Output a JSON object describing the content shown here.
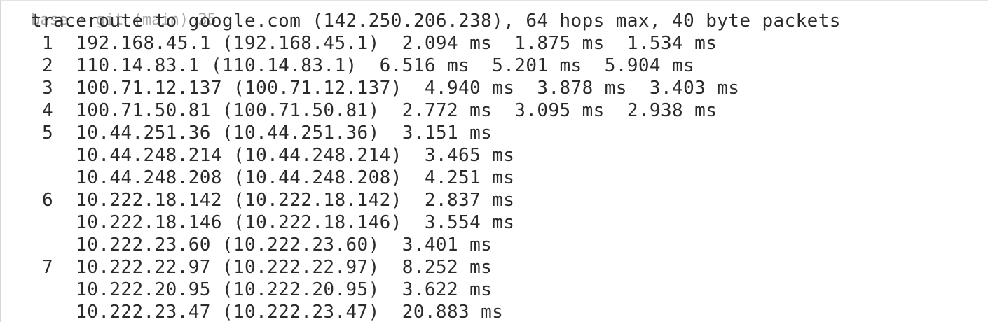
{
  "terminal": {
    "ghost_prompt": "base · git (main) 35",
    "header": "traceroute to google.com (142.250.206.238), 64 hops max, 40 byte packets",
    "lines": [
      " 1  192.168.45.1 (192.168.45.1)  2.094 ms  1.875 ms  1.534 ms",
      " 2  110.14.83.1 (110.14.83.1)  6.516 ms  5.201 ms  5.904 ms",
      " 3  100.71.12.137 (100.71.12.137)  4.940 ms  3.878 ms  3.403 ms",
      " 4  100.71.50.81 (100.71.50.81)  2.772 ms  3.095 ms  2.938 ms",
      " 5  10.44.251.36 (10.44.251.36)  3.151 ms",
      "    10.44.248.214 (10.44.248.214)  3.465 ms",
      "    10.44.248.208 (10.44.248.208)  4.251 ms",
      " 6  10.222.18.142 (10.222.18.142)  2.837 ms",
      "    10.222.18.146 (10.222.18.146)  3.554 ms",
      "    10.222.23.60 (10.222.23.60)  3.401 ms",
      " 7  10.222.22.97 (10.222.22.97)  8.252 ms",
      "    10.222.20.95 (10.222.20.95)  3.622 ms",
      "    10.222.23.47 (10.222.23.47)  20.883 ms"
    ]
  }
}
